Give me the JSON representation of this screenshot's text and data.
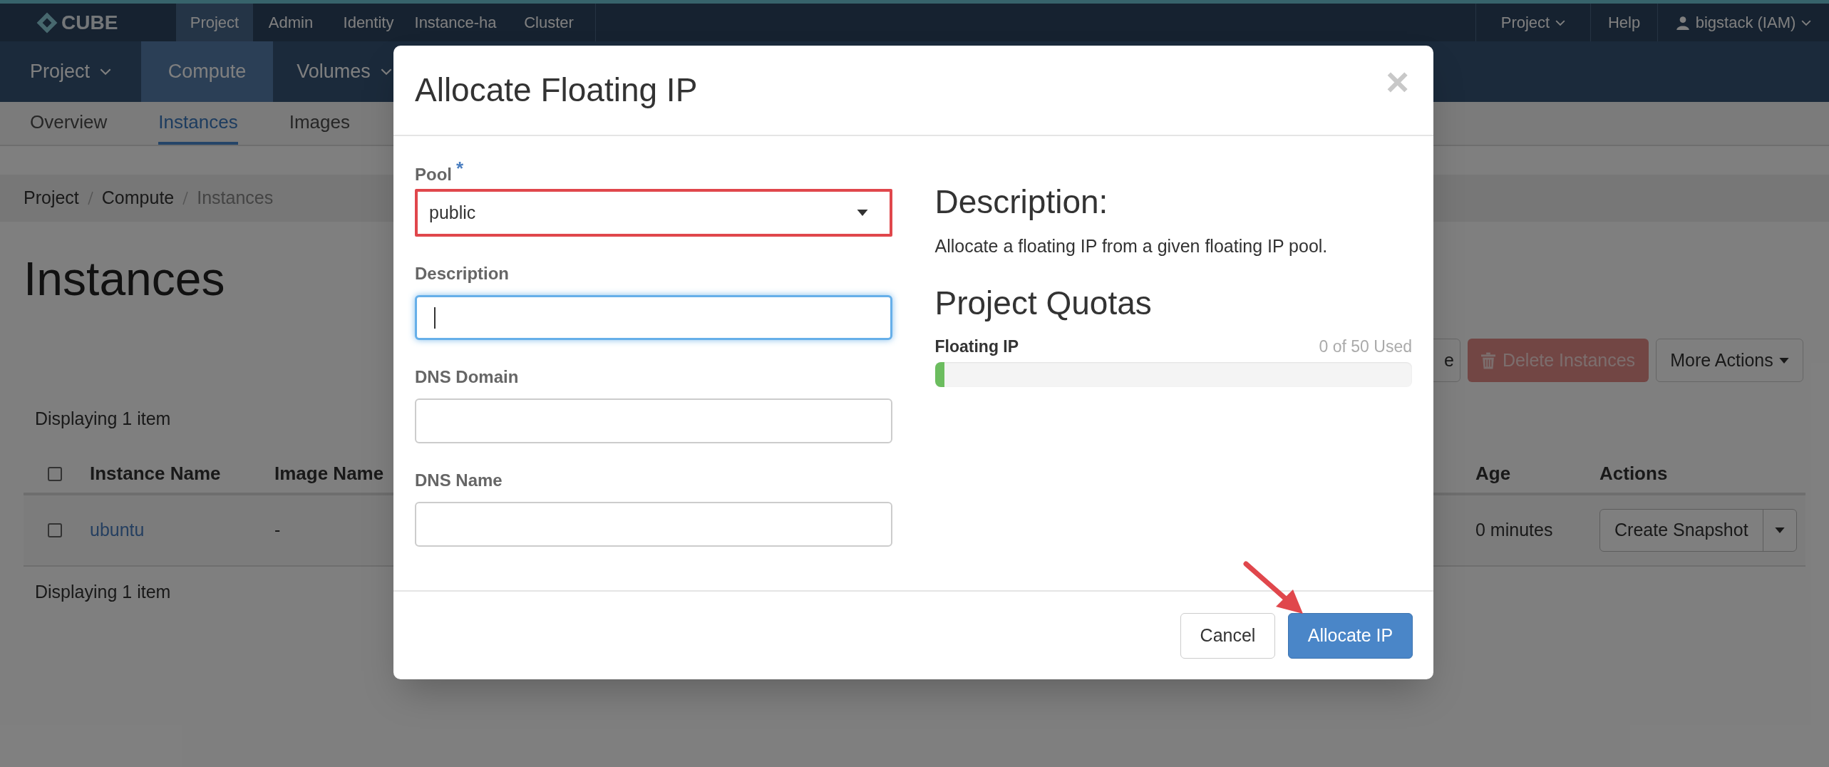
{
  "top_nav": {
    "logo": "CUBE",
    "items": [
      {
        "label": "Project",
        "selected": true
      },
      {
        "label": "Admin",
        "selected": false
      },
      {
        "label": "Identity",
        "selected": false
      },
      {
        "label": "Instance-ha",
        "selected": false
      },
      {
        "label": "Cluster",
        "selected": false
      }
    ],
    "right_items": [
      {
        "kind": "menu",
        "label": "Project"
      },
      {
        "kind": "link",
        "label": "Help"
      },
      {
        "kind": "user",
        "label": "bigstack (IAM)"
      }
    ]
  },
  "section_nav": [
    {
      "label": "Project",
      "selected": false,
      "has_menu": true
    },
    {
      "label": "Compute",
      "selected": true,
      "has_menu": false
    },
    {
      "label": "Volumes",
      "selected": false,
      "has_menu": true
    }
  ],
  "tabs": [
    {
      "label": "Overview",
      "selected": false
    },
    {
      "label": "Instances",
      "selected": true
    },
    {
      "label": "Images",
      "selected": false
    }
  ],
  "breadcrumb": [
    "Project",
    "Compute",
    "Instances"
  ],
  "page_title": "Instances",
  "actions": [
    {
      "kind": "partial",
      "label": "e"
    },
    {
      "kind": "danger",
      "label": "Delete Instances"
    },
    {
      "kind": "menu",
      "label": "More Actions"
    }
  ],
  "table": {
    "count_top": "Displaying 1 item",
    "select_all_checked": false,
    "columns": [
      {
        "label": "Instance Name"
      },
      {
        "label": "Image Name"
      },
      {
        "label": "Age"
      },
      {
        "label": "Actions"
      }
    ],
    "rows": [
      {
        "checked": false,
        "name": "ubuntu",
        "image": "-",
        "age": "0 minutes",
        "action": "Create Snapshot"
      }
    ],
    "count_bottom": "Displaying 1 item"
  },
  "modal": {
    "title": "Allocate Floating IP",
    "close": "×",
    "fields": [
      {
        "kind": "select",
        "label": "Pool",
        "required_mark": "*",
        "value": "public",
        "highlighted": true,
        "focused": false
      },
      {
        "kind": "text",
        "label": "Description",
        "highlighted": false,
        "focused": true
      },
      {
        "kind": "text",
        "label": "DNS Domain",
        "highlighted": false,
        "focused": false
      },
      {
        "kind": "text",
        "label": "DNS Name",
        "highlighted": false,
        "focused": false
      }
    ],
    "description_title": "Description:",
    "description": "Allocate a floating IP from a given floating IP pool.",
    "quotas_title": "Project Quotas",
    "quotas": [
      {
        "label": "Floating IP",
        "usage": "0 of 50 Used",
        "level": 0.02
      }
    ],
    "buttons": [
      {
        "label": "Cancel",
        "primary": false,
        "pointed": false
      },
      {
        "label": "Allocate IP",
        "primary": true,
        "pointed": true
      }
    ]
  }
}
